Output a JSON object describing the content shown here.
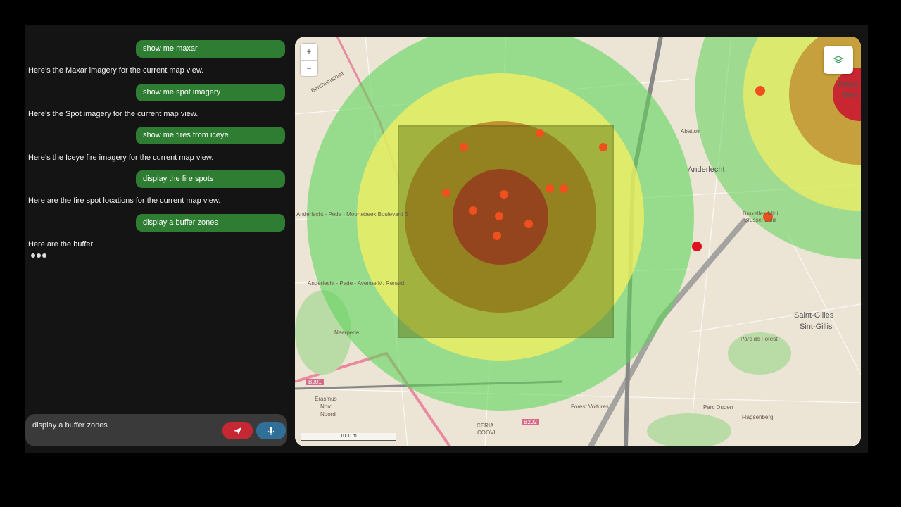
{
  "chat": {
    "messages": [
      {
        "role": "user",
        "text": "show me maxar"
      },
      {
        "role": "assistant",
        "text": "Here’s the Maxar imagery for the current map view."
      },
      {
        "role": "user",
        "text": "show me spot imagery"
      },
      {
        "role": "assistant",
        "text": "Here’s the Spot imagery for the current map view."
      },
      {
        "role": "user",
        "text": "show me fires from iceye"
      },
      {
        "role": "assistant",
        "text": "Here’s the Iceye fire imagery for the current map view."
      },
      {
        "role": "user",
        "text": "display the fire spots"
      },
      {
        "role": "assistant",
        "text": "Here are the fire spot locations for the current map view."
      },
      {
        "role": "user",
        "text": "display a buffer zones"
      },
      {
        "role": "assistant",
        "text": "Here are the buffer"
      }
    ],
    "input_value": "display a buffer zones"
  },
  "map": {
    "zoom_in": "+",
    "zoom_out": "−",
    "scale_label": "1000 m",
    "labels": {
      "berchem": "Berchemstraat",
      "anderlecht": "Anderlecht",
      "bruxelles_midi": "Bruxelles-Midi",
      "brussel_zuid": "Brussel-Zuid",
      "saint_gilles": "Saint-Gilles",
      "sint_gillis": "Sint-Gillis",
      "bruxe": "Bruxe",
      "bruv": "Bruv",
      "neerpede": "Neerpede",
      "erasmus": "Erasmus",
      "nord": "Nord",
      "noord": "Noord",
      "b201": "B201",
      "b202": "B202",
      "ceria": "CERIA",
      "coovi": "COOVI",
      "forest": "Forest Voitures",
      "flagsenberg": "Flagsenberg",
      "parc_forest": "Parc de Forest",
      "parc_duden": "Parc Duden",
      "abattoir": "Abattoir",
      "moortebeek": "Anderlecht - Pede - Moortebeek Boulevard S",
      "pede_avenue": "Anderlecht - Pede - Avenue M. Renard"
    },
    "colors": {
      "green": "#5fd35a",
      "yellow": "#f5f060",
      "orange": "#b46414",
      "red": "#c8102e",
      "olive": "#5a6e0a",
      "fire": "#f0501e",
      "user_bubble": "#2e7d32",
      "send": "#c62833",
      "mic": "#2f6f98"
    }
  }
}
